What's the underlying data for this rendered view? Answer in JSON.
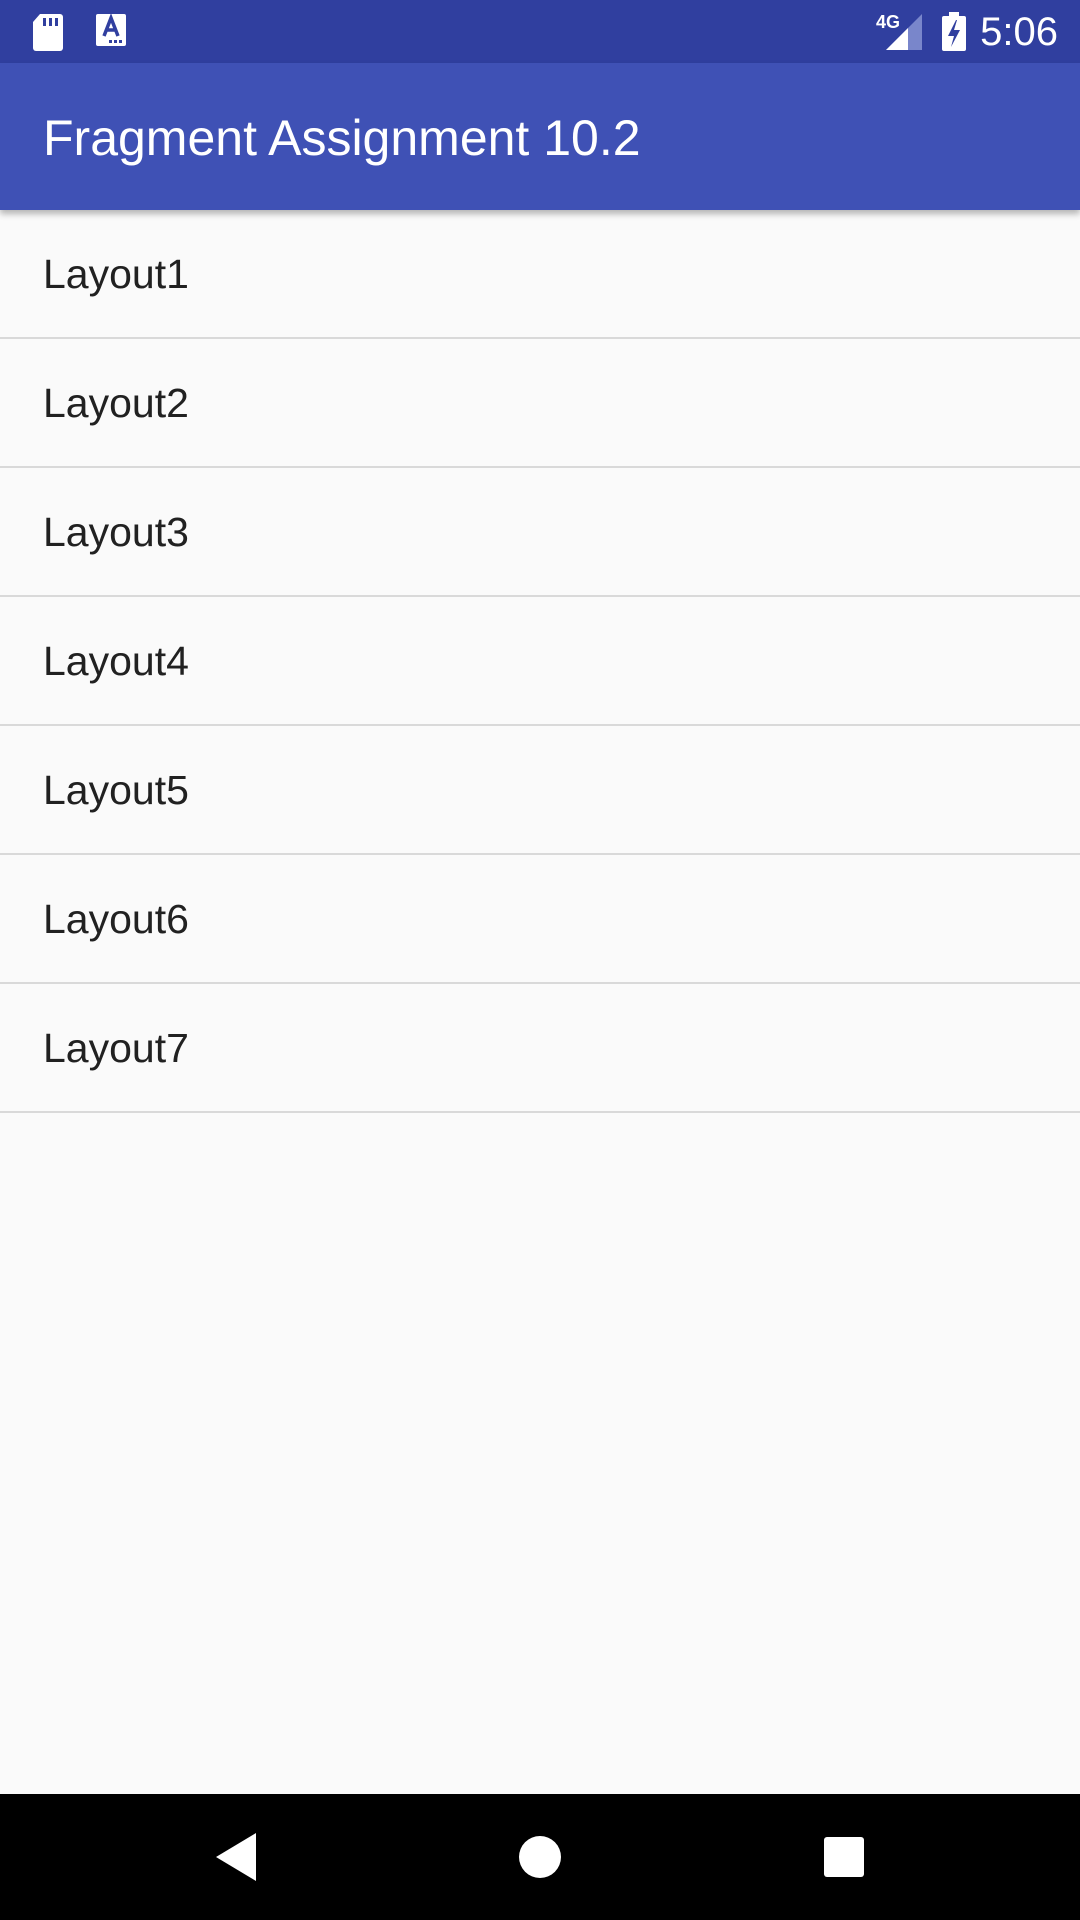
{
  "status_bar": {
    "network_label": "4G",
    "time": "5:06",
    "icons": [
      "sd-card-icon",
      "accessibility-app-icon",
      "signal-icon",
      "battery-charging-icon"
    ]
  },
  "app_bar": {
    "title": "Fragment Assignment 10.2",
    "color": "#3f51b5"
  },
  "list": {
    "items": [
      {
        "label": "Layout1"
      },
      {
        "label": "Layout2"
      },
      {
        "label": "Layout3"
      },
      {
        "label": "Layout4"
      },
      {
        "label": "Layout5"
      },
      {
        "label": "Layout6"
      },
      {
        "label": "Layout7"
      }
    ]
  },
  "nav_bar": {
    "icons": [
      "back-icon",
      "home-icon",
      "recents-icon"
    ]
  },
  "colors": {
    "status_bar": "#303f9f",
    "app_bar": "#3f51b5",
    "background": "#fafafa",
    "divider": "#d9d9d9",
    "text": "#212121"
  }
}
